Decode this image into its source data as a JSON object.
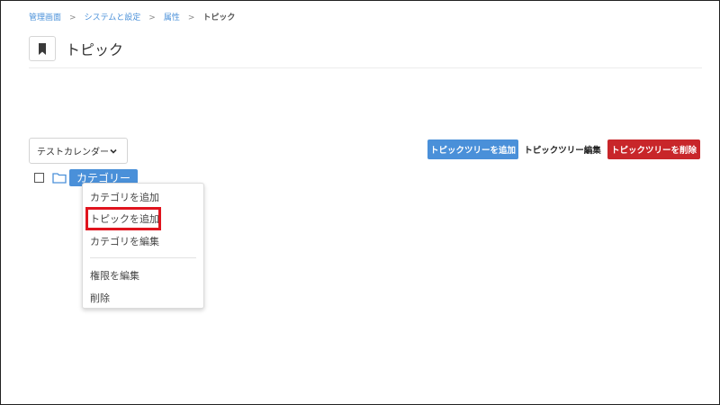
{
  "breadcrumb": {
    "items": [
      "管理画面",
      "システムと設定",
      "属性"
    ],
    "separator": ">",
    "current": "トピック"
  },
  "page": {
    "title": "トピック",
    "icon": "bookmark-icon"
  },
  "calendar_select": {
    "value": "テストカレンダー",
    "icon": "chevron-down-icon"
  },
  "actions": {
    "add_label": "トピックツリーを追加",
    "edit_label": "トピックツリー編集",
    "delete_label": "トピックツリーを削除"
  },
  "tree": {
    "node_label": "カテゴリー",
    "node_icon": "folder-icon"
  },
  "context_menu": {
    "items": [
      "カテゴリを追加",
      "トピックを追加",
      "カテゴリを編集",
      "権限を編集",
      "削除"
    ],
    "highlighted_item": "トピックを追加"
  },
  "colors": {
    "primary": "#4a90d9",
    "danger": "#c8262a",
    "highlight": "#e0141e"
  }
}
